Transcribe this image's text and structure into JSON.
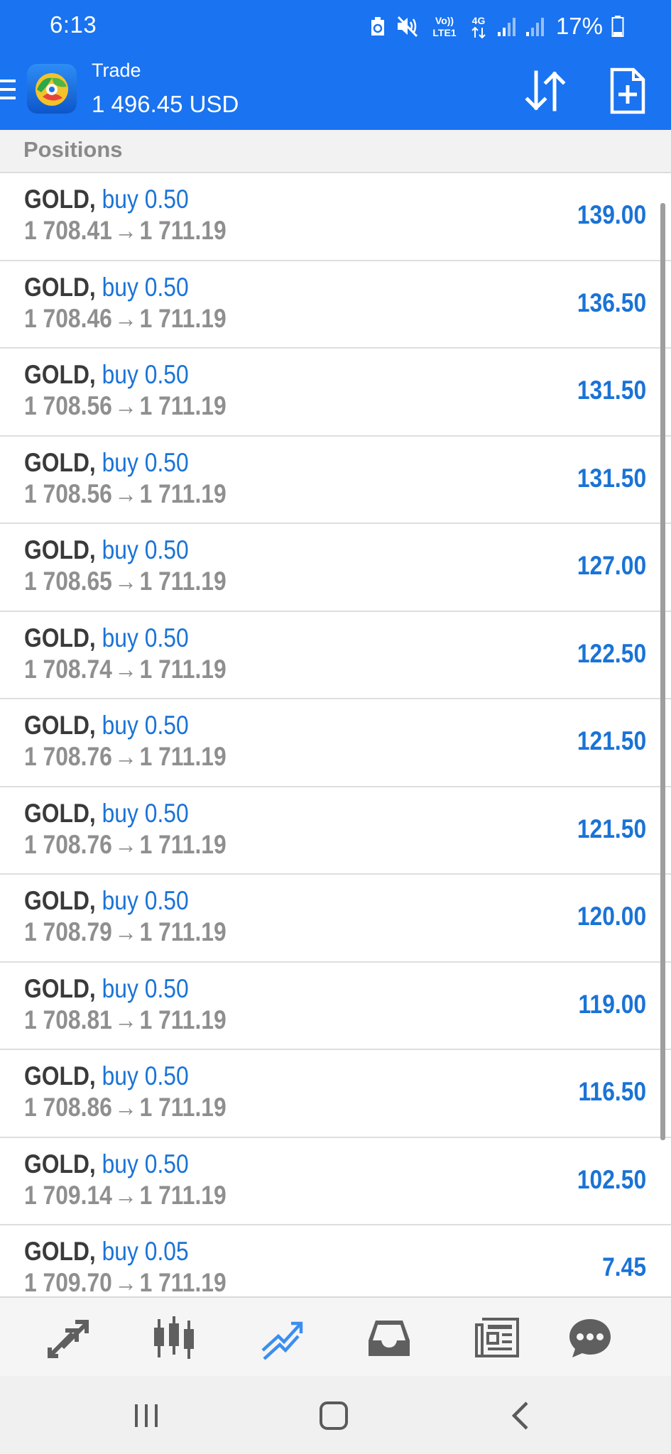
{
  "status_bar": {
    "time": "6:13",
    "network_label_top": "Vo))",
    "network_label_bottom": "LTE1",
    "network_type": "4G",
    "battery": "17%"
  },
  "toolbar": {
    "title": "Trade",
    "balance": "1 496.45 USD",
    "icons": [
      "menu-icon",
      "sort-icon",
      "new-order-icon"
    ]
  },
  "section": {
    "title": "Positions"
  },
  "positions": [
    {
      "symbol": "GOLD",
      "side": "buy",
      "volume": "0.50",
      "open_price": "1 708.41",
      "current_price": "1 711.19",
      "profit": "139.00"
    },
    {
      "symbol": "GOLD",
      "side": "buy",
      "volume": "0.50",
      "open_price": "1 708.46",
      "current_price": "1 711.19",
      "profit": "136.50"
    },
    {
      "symbol": "GOLD",
      "side": "buy",
      "volume": "0.50",
      "open_price": "1 708.56",
      "current_price": "1 711.19",
      "profit": "131.50"
    },
    {
      "symbol": "GOLD",
      "side": "buy",
      "volume": "0.50",
      "open_price": "1 708.56",
      "current_price": "1 711.19",
      "profit": "131.50"
    },
    {
      "symbol": "GOLD",
      "side": "buy",
      "volume": "0.50",
      "open_price": "1 708.65",
      "current_price": "1 711.19",
      "profit": "127.00"
    },
    {
      "symbol": "GOLD",
      "side": "buy",
      "volume": "0.50",
      "open_price": "1 708.74",
      "current_price": "1 711.19",
      "profit": "122.50"
    },
    {
      "symbol": "GOLD",
      "side": "buy",
      "volume": "0.50",
      "open_price": "1 708.76",
      "current_price": "1 711.19",
      "profit": "121.50"
    },
    {
      "symbol": "GOLD",
      "side": "buy",
      "volume": "0.50",
      "open_price": "1 708.76",
      "current_price": "1 711.19",
      "profit": "121.50"
    },
    {
      "symbol": "GOLD",
      "side": "buy",
      "volume": "0.50",
      "open_price": "1 708.79",
      "current_price": "1 711.19",
      "profit": "120.00"
    },
    {
      "symbol": "GOLD",
      "side": "buy",
      "volume": "0.50",
      "open_price": "1 708.81",
      "current_price": "1 711.19",
      "profit": "119.00"
    },
    {
      "symbol": "GOLD",
      "side": "buy",
      "volume": "0.50",
      "open_price": "1 708.86",
      "current_price": "1 711.19",
      "profit": "116.50"
    },
    {
      "symbol": "GOLD",
      "side": "buy",
      "volume": "0.50",
      "open_price": "1 709.14",
      "current_price": "1 711.19",
      "profit": "102.50"
    },
    {
      "symbol": "GOLD",
      "side": "buy",
      "volume": "0.05",
      "open_price": "1 709.70",
      "current_price": "1 711.19",
      "profit": "7.45"
    }
  ],
  "bottom_nav": {
    "items": [
      {
        "icon": "quotes-icon",
        "active": false
      },
      {
        "icon": "chart-icon",
        "active": false
      },
      {
        "icon": "trade-icon",
        "active": true
      },
      {
        "icon": "history-icon",
        "active": false
      },
      {
        "icon": "news-icon",
        "active": false
      },
      {
        "icon": "chat-icon",
        "active": false
      }
    ]
  },
  "system_nav": {
    "buttons": [
      "recents-icon",
      "home-icon",
      "back-icon"
    ]
  },
  "colors": {
    "header_blue": "#1a73f0",
    "accent_blue": "#1a73d6",
    "symbol_text": "#3a3a3a",
    "price_text": "#8f8f8f",
    "nav_icon_gray": "#5f5f5f"
  }
}
